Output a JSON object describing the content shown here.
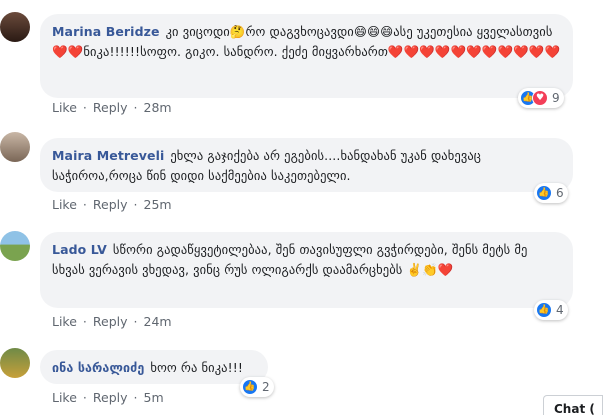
{
  "comments": [
    {
      "name": "Marina Beridze",
      "text": "კი ვიცოდი🤔რო დაგვხოცავდი😄😄😄ასე უკეთესია ყველასთვის❤️❤️ნიკა!!!!!!სოფო. გიკო. სანდრო. ქეძე მიყვარხართ❤️❤️❤️❤️❤️❤️❤️❤️❤️❤️❤️",
      "like": "Like",
      "reply": "Reply",
      "time": "28m",
      "reactions": "9"
    },
    {
      "name": "Maira Metreveli",
      "text": "ეხლა გაჯიქება არ ეგების....ხანდახან უკან დახევაც საჭიროა,როცა წინ დიდი საქმეებია საკეთებელი.",
      "like": "Like",
      "reply": "Reply",
      "time": "25m",
      "reactions": "6"
    },
    {
      "name": "Lado LV",
      "text": "სწორი გადაწყვეტილებაა, შენ თავისუფლი გვჭირდები, შენს მეტს მე სხვას ვერავის ვხედავ, ვინც რუს ოლიგარქს დაამარცხებს ✌️👏❤️",
      "like": "Like",
      "reply": "Reply",
      "time": "24m",
      "reactions": "4"
    },
    {
      "name": "ინა სარალიძე",
      "text": "ხოო რა ნიკა!!!",
      "like": "Like",
      "reply": "Reply",
      "time": "5m",
      "reactions": "2"
    }
  ],
  "chat_tab": "Chat (",
  "colors": {
    "bubble": "#f2f3f5",
    "name": "#385898",
    "like": "#1877f2",
    "love": "#f33e58"
  },
  "icons": {
    "like": "like-icon",
    "love": "love-icon"
  }
}
